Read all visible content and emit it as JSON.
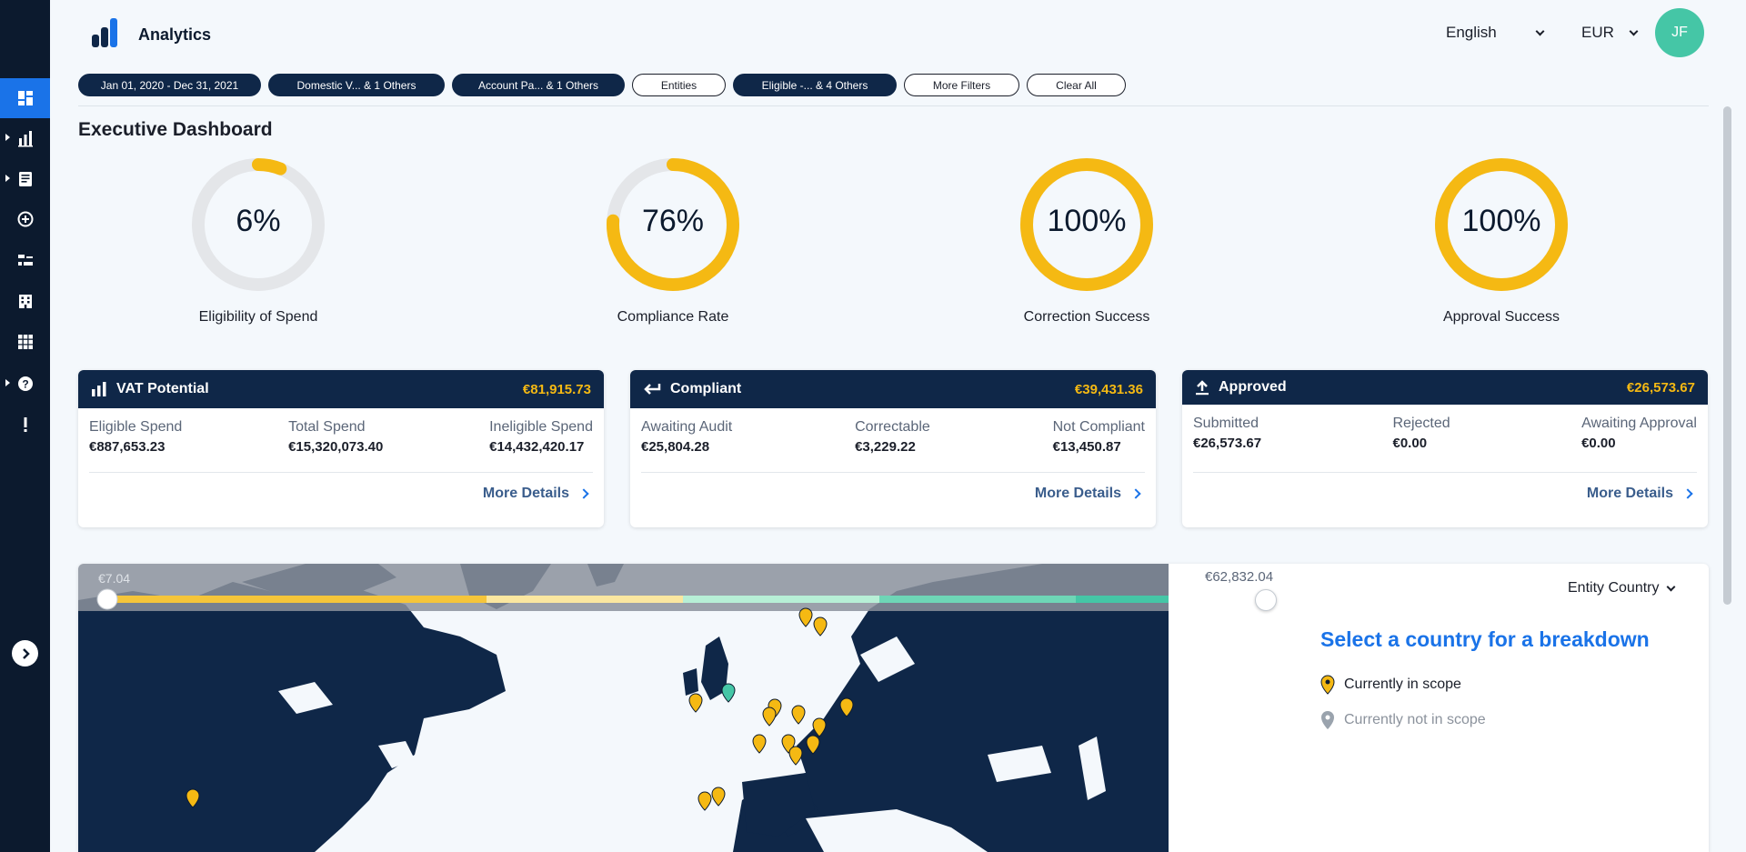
{
  "app": {
    "title": "Analytics"
  },
  "header": {
    "language": "English",
    "currency": "EUR",
    "avatar_initials": "JF"
  },
  "sidebar": {
    "items": [
      {
        "icon": "dashboard-icon",
        "active": true
      },
      {
        "icon": "bar-chart-icon",
        "caret": true
      },
      {
        "icon": "report-icon",
        "caret": true
      },
      {
        "icon": "add-circle-icon"
      },
      {
        "icon": "list-icon"
      },
      {
        "icon": "building-icon"
      },
      {
        "icon": "apps-grid-icon"
      },
      {
        "icon": "help-icon",
        "caret": true
      },
      {
        "icon": "alert-icon"
      }
    ],
    "expand_icon": "chevron-right-icon"
  },
  "filters": [
    {
      "label": "Jan 01, 2020 - Dec 31, 2021",
      "style": "dark"
    },
    {
      "label": "Domestic V... & 1 Others",
      "style": "dark"
    },
    {
      "label": "Account Pa... & 1 Others",
      "style": "dark"
    },
    {
      "label": "Entities",
      "style": "light"
    },
    {
      "label": "Eligible -... & 4 Others",
      "style": "dark"
    },
    {
      "label": "More Filters",
      "style": "light"
    },
    {
      "label": "Clear All",
      "style": "light"
    }
  ],
  "page_title": "Executive Dashboard",
  "gauges": [
    {
      "value_text": "6%",
      "fraction": 0.06,
      "label": "Eligibility of Spend"
    },
    {
      "value_text": "76%",
      "fraction": 0.76,
      "label": "Compliance Rate"
    },
    {
      "value_text": "100%",
      "fraction": 1.0,
      "label": "Correction Success"
    },
    {
      "value_text": "100%",
      "fraction": 1.0,
      "label": "Approval Success"
    }
  ],
  "cards": [
    {
      "icon": "bar-chart-icon",
      "title": "VAT Potential",
      "amount": "€81,915.73",
      "metrics": [
        {
          "label": "Eligible Spend",
          "value": "€887,653.23"
        },
        {
          "label": "Total Spend",
          "value": "€15,320,073.40"
        },
        {
          "label": "Ineligible Spend",
          "value": "€14,432,420.17"
        }
      ],
      "more": "More Details"
    },
    {
      "icon": "return-arrow-icon",
      "title": "Compliant",
      "amount": "€39,431.36",
      "metrics": [
        {
          "label": "Awaiting Audit",
          "value": "€25,804.28"
        },
        {
          "label": "Correctable",
          "value": "€3,229.22"
        },
        {
          "label": "Not Compliant",
          "value": "€13,450.87"
        }
      ],
      "more": "More Details"
    },
    {
      "icon": "upload-icon",
      "title": "Approved",
      "amount": "€26,573.67",
      "metrics": [
        {
          "label": "Submitted",
          "value": "€26,573.67"
        },
        {
          "label": "Rejected",
          "value": "€0.00"
        },
        {
          "label": "Awaiting Approval",
          "value": "€0.00"
        }
      ],
      "more": "More Details"
    }
  ],
  "map": {
    "slider_min": "€7.04",
    "slider_max": "€62,832.04",
    "entity_select": "Entity Country",
    "breakdown_title": "Select a country for a breakdown",
    "legend": [
      {
        "label": "Currently in scope",
        "color": "#f5b913"
      },
      {
        "label": "Currently not in scope",
        "color": "#9aa3ad"
      }
    ],
    "colors": {
      "land": "#0f2748",
      "water": "#f4f8fc",
      "pin_in_scope": "#f5b913",
      "pin_selected": "#45c6a6"
    }
  },
  "colors": {
    "accent": "#1a73e8",
    "gauge": "#f5b913",
    "gauge_track": "#e4e6e9",
    "navy": "#0f2748"
  }
}
